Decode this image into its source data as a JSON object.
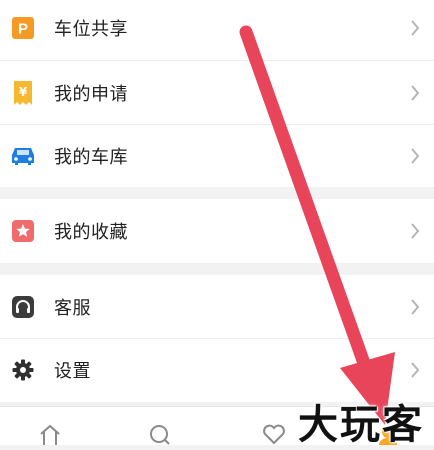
{
  "menu": {
    "group1": [
      {
        "label": "车位共享",
        "icon": "parking-p-icon",
        "color": "#f59a23"
      },
      {
        "label": "我的申请",
        "icon": "yen-receipt-icon",
        "color": "#f5b82e"
      },
      {
        "label": "我的车库",
        "icon": "car-icon",
        "color": "#1f7fe0"
      }
    ],
    "group2": [
      {
        "label": "我的收藏",
        "icon": "star-icon",
        "color": "#f06b6b"
      }
    ],
    "group3": [
      {
        "label": "客服",
        "icon": "headset-icon",
        "color": "#3c3c3c"
      },
      {
        "label": "设置",
        "icon": "gear-icon",
        "color": "#2f2f2f"
      }
    ]
  },
  "tabbar": {
    "tabs": [
      {
        "icon": "home-icon"
      },
      {
        "icon": "search-icon"
      },
      {
        "icon": "heart-icon"
      },
      {
        "icon": "profile-icon",
        "color": "#f5a623"
      }
    ]
  },
  "overlay": {
    "watermark": "大玩客",
    "arrow_color": "#e8455a"
  }
}
